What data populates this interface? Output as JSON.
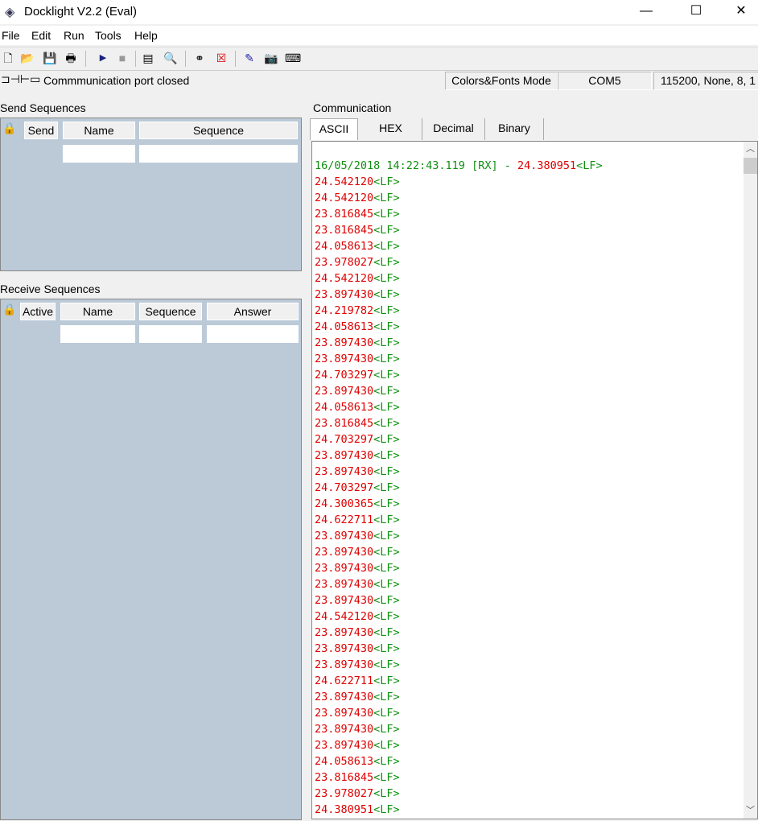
{
  "window": {
    "title": "Docklight V2.2 (Eval)",
    "minimize": "—",
    "maximize": "☐",
    "close": "✕"
  },
  "menu": [
    "File",
    "Edit",
    "Run",
    "Tools",
    "Help"
  ],
  "toolbar": [
    "new-icon",
    "open-icon",
    "save-icon",
    "print-icon",
    "run-icon",
    "stop-icon",
    "settings-icon",
    "options-icon",
    "find-icon",
    "clear-icon",
    "edit-icon",
    "snapshot-icon",
    "keyboard-icon"
  ],
  "status": {
    "message": "Commmunication port closed",
    "mode": "Colors&Fonts Mode",
    "port": "COM5",
    "settings": "115200, None, 8, 1"
  },
  "send": {
    "title": "Send Sequences",
    "cols": [
      "Send",
      "Name",
      "Sequence"
    ]
  },
  "receive": {
    "title": "Receive Sequences",
    "cols": [
      "Active",
      "Name",
      "Sequence",
      "Answer"
    ]
  },
  "communication": {
    "title": "Communication",
    "tabs": [
      "ASCII",
      "HEX",
      "Decimal",
      "Binary"
    ],
    "active_tab": "ASCII",
    "header": {
      "timestamp": "16/05/2018 14:22:43.119 [RX] - ",
      "value": "24.380951",
      "lf": "<LF>"
    },
    "lines": [
      "24.542120",
      "24.542120",
      "23.816845",
      "23.816845",
      "24.058613",
      "23.978027",
      "24.542120",
      "23.897430",
      "24.219782",
      "24.058613",
      "23.897430",
      "23.897430",
      "24.703297",
      "23.897430",
      "24.058613",
      "23.816845",
      "24.703297",
      "23.897430",
      "23.897430",
      "24.703297",
      "24.300365",
      "24.622711",
      "23.897430",
      "23.897430",
      "23.897430",
      "23.897430",
      "23.897430",
      "24.542120",
      "23.897430",
      "23.897430",
      "23.897430",
      "24.622711",
      "23.897430",
      "23.897430",
      "23.897430",
      "23.897430",
      "24.058613",
      "23.816845",
      "23.978027",
      "24.380951"
    ],
    "colors": {
      "data": "#e00000",
      "control": "#109010"
    }
  }
}
